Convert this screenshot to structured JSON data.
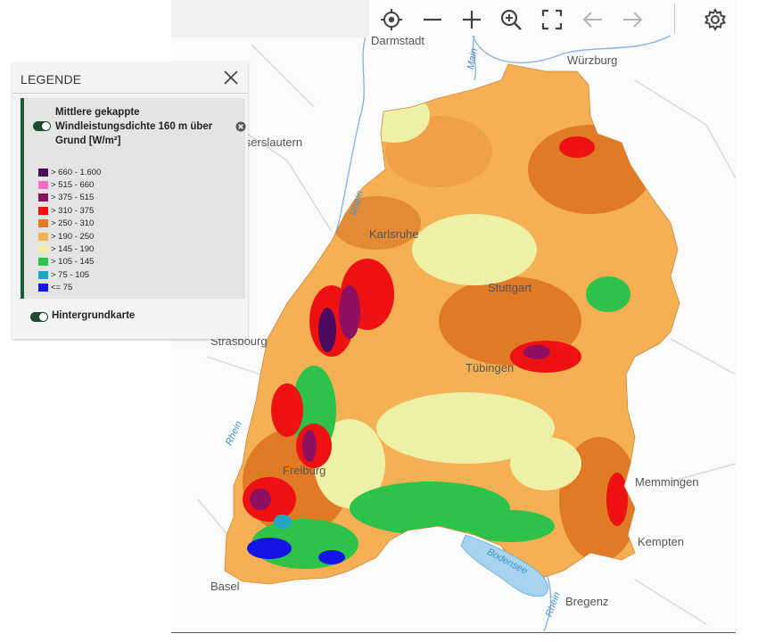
{
  "legend": {
    "title": "LEGENDE",
    "layer": {
      "name": "Mittlere gekappte Windleistungsdichte 160 m über Grund [W/m²]",
      "classes": [
        {
          "label": "> 660 - 1.600",
          "color": "#4b0a5e"
        },
        {
          "label": "> 515 - 660",
          "color": "#f46fc7"
        },
        {
          "label": "> 375 - 515",
          "color": "#8f0f63"
        },
        {
          "label": "> 310 - 375",
          "color": "#ee1111"
        },
        {
          "label": "> 250 - 310",
          "color": "#e07a25"
        },
        {
          "label": "> 190 - 250",
          "color": "#f4b052"
        },
        {
          "label": "> 145 - 190",
          "color": "#eef0a6"
        },
        {
          "label": "> 105 - 145",
          "color": "#2ec24a"
        },
        {
          "label": "> 75 - 105",
          "color": "#21a8c0"
        },
        {
          "label": "<= 75",
          "color": "#1414e6"
        }
      ]
    },
    "background_layer": "Hintergrundkarte"
  },
  "map": {
    "cities": {
      "darmstadt": "Darmstadt",
      "wuerzburg": "Würzburg",
      "kaiserslautern": "Kaiserslautern",
      "karlsruhe": "Karlsruhe",
      "stuttgart": "Stuttgart",
      "strasbourg": "Strasbourg",
      "tuebingen": "Tübingen",
      "freiburg": "Freiburg",
      "memmingen": "Memmingen",
      "kempten": "Kempten",
      "basel": "Basel",
      "bregenz": "Bregenz"
    },
    "rivers": {
      "main": "Main",
      "rhein_north": "Rhein",
      "rhein_west": "Rhein",
      "rhein_south": "Rhein"
    },
    "lake": "Bodensee"
  },
  "toolbar": {
    "icons": [
      "locate-icon",
      "zoom-out-icon",
      "zoom-in-icon",
      "zoom-magnifier-icon",
      "fullscreen-icon",
      "back-arrow-icon",
      "forward-arrow-icon",
      "settings-gear-icon"
    ]
  }
}
